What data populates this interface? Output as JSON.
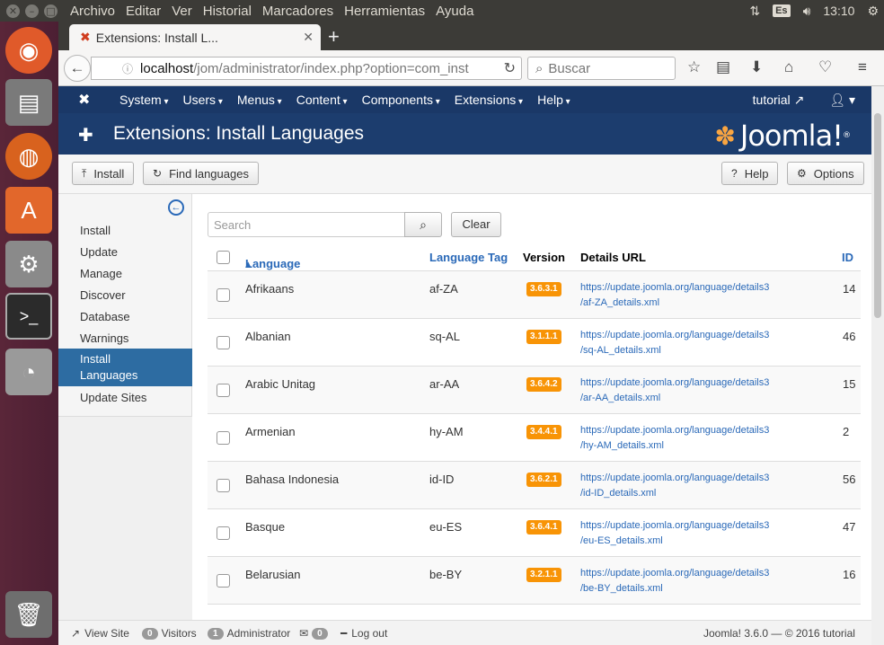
{
  "top_panel": {
    "app_menu": [
      "Archivo",
      "Editar",
      "Ver",
      "Historial",
      "Marcadores",
      "Herramientas",
      "Ayuda"
    ],
    "keyboard_layout": "Es",
    "clock": "13:10"
  },
  "browser": {
    "tab_title": "Extensions: Install L...",
    "url_host": "localhost",
    "url_path": "/jom/administrator/index.php?option=com_inst",
    "search_placeholder": "Buscar"
  },
  "joomla": {
    "nav": {
      "items": [
        "System",
        "Users",
        "Menus",
        "Content",
        "Components",
        "Extensions",
        "Help"
      ],
      "site_link": "tutorial"
    },
    "header": {
      "title": "Extensions: Install Languages",
      "brand": "Joomla!"
    },
    "toolbar": {
      "install": "Install",
      "find_languages": "Find languages",
      "help": "Help",
      "options": "Options"
    },
    "sidebar": {
      "items": [
        "Install",
        "Update",
        "Manage",
        "Discover",
        "Database",
        "Warnings",
        "Install Languages",
        "Update Sites"
      ],
      "active": "Install Languages"
    },
    "filter": {
      "search_placeholder": "Search",
      "clear": "Clear"
    },
    "table": {
      "headers": {
        "language": "Language",
        "tag": "Language Tag",
        "version": "Version",
        "url": "Details URL",
        "id": "ID"
      },
      "rows": [
        {
          "language": "Afrikaans",
          "tag": "af-ZA",
          "version": "3.6.3.1",
          "url1": "https://update.joomla.org/language/details3",
          "url2": "/af-ZA_details.xml",
          "id": "14"
        },
        {
          "language": "Albanian",
          "tag": "sq-AL",
          "version": "3.1.1.1",
          "url1": "https://update.joomla.org/language/details3",
          "url2": "/sq-AL_details.xml",
          "id": "46"
        },
        {
          "language": "Arabic Unitag",
          "tag": "ar-AA",
          "version": "3.6.4.2",
          "url1": "https://update.joomla.org/language/details3",
          "url2": "/ar-AA_details.xml",
          "id": "15"
        },
        {
          "language": "Armenian",
          "tag": "hy-AM",
          "version": "3.4.4.1",
          "url1": "https://update.joomla.org/language/details3",
          "url2": "/hy-AM_details.xml",
          "id": "2"
        },
        {
          "language": "Bahasa Indonesia",
          "tag": "id-ID",
          "version": "3.6.2.1",
          "url1": "https://update.joomla.org/language/details3",
          "url2": "/id-ID_details.xml",
          "id": "56"
        },
        {
          "language": "Basque",
          "tag": "eu-ES",
          "version": "3.6.4.1",
          "url1": "https://update.joomla.org/language/details3",
          "url2": "/eu-ES_details.xml",
          "id": "47"
        },
        {
          "language": "Belarusian",
          "tag": "be-BY",
          "version": "3.2.1.1",
          "url1": "https://update.joomla.org/language/details3",
          "url2": "/be-BY_details.xml",
          "id": "16"
        }
      ]
    },
    "status": {
      "view_site": "View Site",
      "visitors_count": "0",
      "visitors": "Visitors",
      "admin_count": "1",
      "administrator": "Administrator",
      "messages_count": "0",
      "logout": "Log out",
      "footer": "Joomla! 3.6.0  —  © 2016 tutorial"
    }
  }
}
